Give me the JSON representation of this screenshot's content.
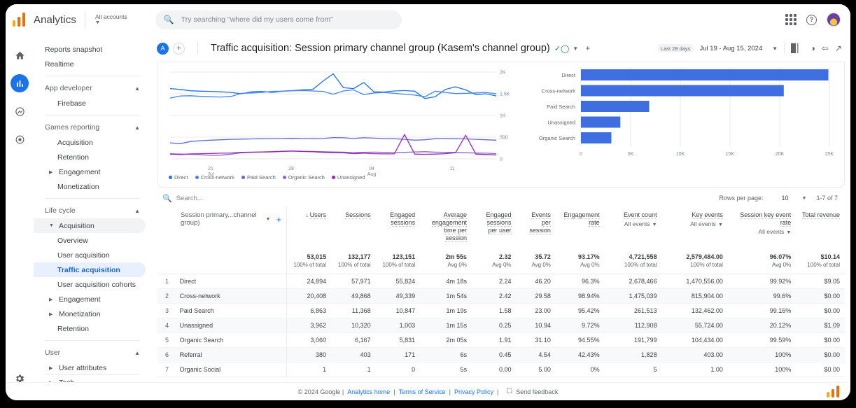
{
  "topbar": {
    "brand": "Analytics",
    "account_label": "All accounts",
    "search_placeholder": "Try searching \"where did my users come from\"",
    "icons": {
      "search": "search-icon",
      "apps": "apps-grid-icon",
      "help": "help-icon",
      "avatar": "user-avatar"
    }
  },
  "rail": {
    "items": [
      {
        "name": "home",
        "label": "Home"
      },
      {
        "name": "reports",
        "label": "Reports"
      },
      {
        "name": "explore",
        "label": "Explore"
      },
      {
        "name": "advertising",
        "label": "Advertising"
      }
    ],
    "settings": "Admin"
  },
  "sidebar": {
    "items": [
      {
        "label": "Reports snapshot",
        "type": "item"
      },
      {
        "label": "Realtime",
        "type": "item"
      },
      {
        "label": "App developer",
        "type": "section"
      },
      {
        "label": "Firebase",
        "type": "sub"
      },
      {
        "label": "Games reporting",
        "type": "section"
      },
      {
        "label": "Acquisition",
        "type": "sub"
      },
      {
        "label": "Retention",
        "type": "sub"
      },
      {
        "label": "Engagement",
        "type": "sub-expandable"
      },
      {
        "label": "Monetization",
        "type": "sub"
      },
      {
        "label": "Life cycle",
        "type": "section"
      },
      {
        "label": "Acquisition",
        "type": "sub-expandable-open"
      },
      {
        "label": "Overview",
        "type": "subsub"
      },
      {
        "label": "User acquisition",
        "type": "subsub"
      },
      {
        "label": "Traffic acquisition",
        "type": "subsub-selected"
      },
      {
        "label": "User acquisition cohorts",
        "type": "subsub"
      },
      {
        "label": "Engagement",
        "type": "sub-expandable"
      },
      {
        "label": "Monetization",
        "type": "sub-expandable"
      },
      {
        "label": "Retention",
        "type": "sub"
      },
      {
        "label": "User",
        "type": "section"
      },
      {
        "label": "User attributes",
        "type": "sub-expandable"
      },
      {
        "label": "Tech",
        "type": "sub-expandable"
      }
    ]
  },
  "report_header": {
    "avatar_letter": "A",
    "add_label": "+",
    "title": "Traffic acquisition: Session primary channel group (Kasem's channel group)",
    "verified_icon": "verified-check-icon",
    "caret": "▾",
    "add_comparison": "+",
    "date_badge": "Last 28 days",
    "date_range": "Jul 19 - Aug 15, 2024",
    "date_caret": "▾",
    "actions": [
      "compare-icon",
      "insights-icon",
      "share-icon",
      "trend-icon"
    ]
  },
  "chart_data": [
    {
      "type": "line",
      "title": "",
      "xlabel": "",
      "ylabel": "",
      "ylim": [
        0,
        2000
      ],
      "yticks": [
        "0",
        "500",
        "1K",
        "1.5K",
        "2K"
      ],
      "xticks": [
        "21\nJul",
        "28",
        "04\nAug",
        "11"
      ],
      "legend": [
        "Direct",
        "Cross-network",
        "Paid Search",
        "Organic Search",
        "Unassigned"
      ],
      "colors": [
        "#1a73e8",
        "#4285f4",
        "#5e6bd6",
        "#8f63d4",
        "#9c27b0"
      ],
      "series": [
        {
          "name": "Direct",
          "color": "#1a73e8",
          "values": [
            1620,
            1600,
            1570,
            1560,
            1555,
            1545,
            1530,
            1500,
            1545,
            1555,
            1530,
            1560,
            1575,
            1590,
            1600,
            1790,
            1960,
            1640,
            1620,
            1760,
            1545,
            1540,
            1565,
            1575,
            1560,
            1390,
            1430,
            1600,
            1660,
            1590,
            1480,
            1500,
            1450
          ]
        },
        {
          "name": "Cross-network",
          "color": "#4285f4",
          "values": [
            1400,
            1450,
            1455,
            1440,
            1430,
            1425,
            1440,
            1510,
            1520,
            1530,
            1555,
            1560,
            1570,
            1575,
            1565,
            1555,
            1490,
            1565,
            1590,
            1480,
            1520,
            1530,
            1510,
            1490,
            1470,
            1430,
            1560,
            1530,
            1505,
            1510,
            1520,
            1530,
            1500
          ]
        },
        {
          "name": "Paid Search",
          "color": "#5e6bd6",
          "values": [
            370,
            350,
            400,
            420,
            430,
            440,
            450,
            455,
            460,
            465,
            468,
            470,
            472,
            470,
            465,
            470,
            490,
            485,
            470,
            485,
            478,
            470,
            465,
            450,
            430,
            440,
            465,
            470,
            465,
            460,
            450,
            440,
            430
          ]
        },
        {
          "name": "Organic Search",
          "color": "#8f63d4",
          "values": [
            120,
            110,
            105,
            95,
            80,
            85,
            110,
            140,
            150,
            155,
            160,
            170,
            180,
            175,
            170,
            165,
            160,
            155,
            145,
            150,
            155,
            150,
            145,
            150,
            160,
            165,
            155,
            150,
            148,
            140,
            135,
            130,
            120
          ]
        },
        {
          "name": "Unassigned",
          "color": "#9c27b0",
          "values": [
            110,
            100,
            115,
            120,
            125,
            130,
            135,
            150,
            155,
            160,
            165,
            175,
            180,
            170,
            165,
            150,
            140,
            140,
            120,
            130,
            120,
            115,
            115,
            560,
            110,
            105,
            110,
            120,
            140,
            545,
            110,
            100,
            90
          ]
        }
      ]
    },
    {
      "type": "bar",
      "orientation": "horizontal",
      "title": "",
      "categories": [
        "Direct",
        "Cross-network",
        "Paid Search",
        "Unassigned",
        "Organic Search"
      ],
      "values": [
        24894,
        20408,
        6863,
        3962,
        3060
      ],
      "xticks": [
        "0",
        "5K",
        "10K",
        "15K",
        "20K",
        "25K"
      ],
      "xlim": [
        0,
        25000
      ],
      "color": "#3f6ee0"
    }
  ],
  "table": {
    "search_placeholder": "Search...",
    "rows_per_page_label": "Rows per page:",
    "rows_per_page_value": "10",
    "pagination": "1-7 of 7",
    "dimension_label": "Session primary...channel group)",
    "columns": [
      {
        "label": "Users",
        "sorted": true
      },
      {
        "label": "Sessions"
      },
      {
        "label": "Engaged sessions"
      },
      {
        "label": "Average engagement time per session"
      },
      {
        "label": "Engaged sessions per user"
      },
      {
        "label": "Events per session"
      },
      {
        "label": "Engagement rate"
      },
      {
        "label": "Event count",
        "sub": "All events"
      },
      {
        "label": "Key events",
        "sub": "All events"
      },
      {
        "label": "Session key event rate",
        "sub": "All events"
      },
      {
        "label": "Total revenue"
      }
    ],
    "totals": [
      {
        "value": "53,015",
        "sub": "100% of total"
      },
      {
        "value": "132,177",
        "sub": "100% of total"
      },
      {
        "value": "123,151",
        "sub": "100% of total"
      },
      {
        "value": "2m 55s",
        "sub": "Avg 0%"
      },
      {
        "value": "2.32",
        "sub": "Avg 0%"
      },
      {
        "value": "35.72",
        "sub": "Avg 0%"
      },
      {
        "value": "93.17%",
        "sub": "Avg 0%"
      },
      {
        "value": "4,721,558",
        "sub": "100% of total"
      },
      {
        "value": "2,579,484.00",
        "sub": "100% of total"
      },
      {
        "value": "96.07%",
        "sub": "Avg 0%"
      },
      {
        "value": "$10.14",
        "sub": "100% of total"
      }
    ],
    "rows": [
      {
        "idx": "1",
        "name": "Direct",
        "cells": [
          "24,894",
          "57,971",
          "55,824",
          "4m 18s",
          "2.24",
          "46.20",
          "96.3%",
          "2,678,466",
          "1,470,556.00",
          "99.92%",
          "$9.05"
        ]
      },
      {
        "idx": "2",
        "name": "Cross-network",
        "cells": [
          "20,408",
          "49,868",
          "49,339",
          "1m 54s",
          "2.42",
          "29.58",
          "98.94%",
          "1,475,039",
          "815,904.00",
          "99.6%",
          "$0.00"
        ]
      },
      {
        "idx": "3",
        "name": "Paid Search",
        "cells": [
          "6,863",
          "11,368",
          "10,847",
          "1m 19s",
          "1.58",
          "23.00",
          "95.42%",
          "261,513",
          "132,462.00",
          "99.16%",
          "$0.00"
        ]
      },
      {
        "idx": "4",
        "name": "Unassigned",
        "cells": [
          "3,962",
          "10,320",
          "1,003",
          "1m 15s",
          "0.25",
          "10.94",
          "9.72%",
          "112,908",
          "55,724.00",
          "20.12%",
          "$1.09"
        ]
      },
      {
        "idx": "5",
        "name": "Organic Search",
        "cells": [
          "3,060",
          "6,167",
          "5,831",
          "2m 05s",
          "1.91",
          "31.10",
          "94.55%",
          "191,799",
          "104,434.00",
          "99.59%",
          "$0.00"
        ]
      },
      {
        "idx": "6",
        "name": "Referral",
        "cells": [
          "380",
          "403",
          "171",
          "6s",
          "0.45",
          "4.54",
          "42.43%",
          "1,828",
          "403.00",
          "100%",
          "$0.00"
        ]
      },
      {
        "idx": "7",
        "name": "Organic Social",
        "cells": [
          "1",
          "1",
          "0",
          "5s",
          "0.00",
          "5.00",
          "0%",
          "5",
          "1.00",
          "100%",
          "$0.00"
        ]
      }
    ]
  },
  "footer": {
    "copyright": "© 2024 Google |",
    "links": [
      "Analytics home",
      "Terms of Service",
      "Privacy Policy"
    ],
    "feedback": "Send feedback"
  }
}
